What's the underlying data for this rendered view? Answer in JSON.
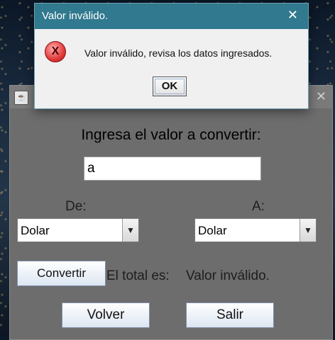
{
  "main_window": {
    "heading": "Ingresa el valor a convertir:",
    "input_value": "a",
    "label_from": "De:",
    "label_to": "A:",
    "from_currency": "Dolar",
    "to_currency": "Dolar",
    "convert_label": "Convertir",
    "total_label": "El total es:",
    "total_value": "Valor inválido.",
    "back_label": "Volver",
    "exit_label": "Salir",
    "close_glyph": "✕"
  },
  "dialog": {
    "title": "Valor inválido.",
    "message": "Valor inválido, revisa los datos ingresados.",
    "ok_label": "OK",
    "icon": "error-icon",
    "close_glyph": "✕"
  },
  "colors": {
    "dialog_titlebar": "#30798e",
    "window_body": "#6d6d6d"
  }
}
